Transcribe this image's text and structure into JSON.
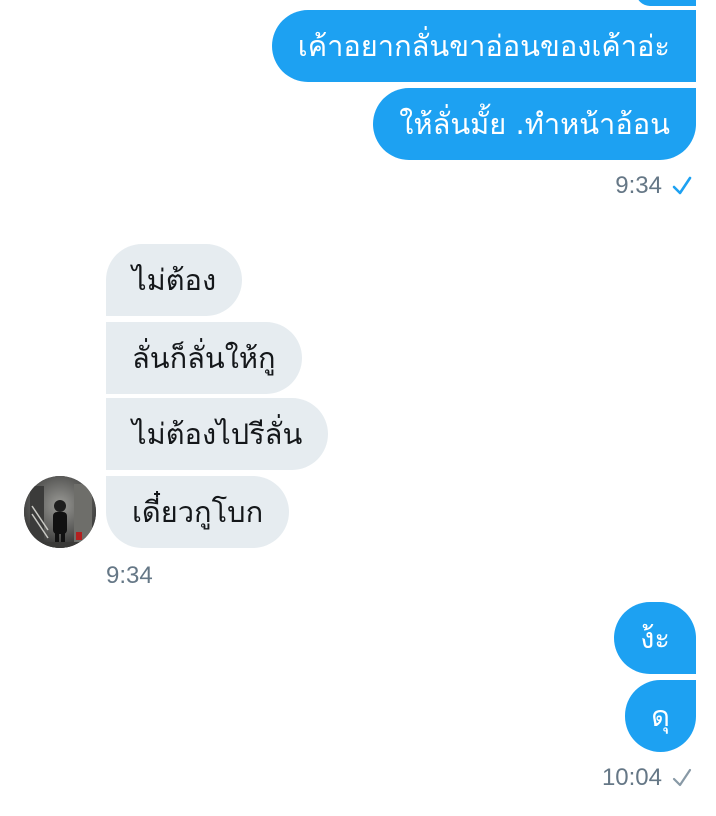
{
  "conversation": {
    "outgoing_group_1": {
      "messages": [
        "เค้าอยากลั่นขาอ่อนของเค้าอ่ะ",
        "ให้ลั่นมั้ย .ทำหน้าอ้อน"
      ],
      "time": "9:34",
      "status_icon": "check-icon",
      "status_color": "#1da1f2"
    },
    "incoming_group": {
      "messages": [
        "ไม่ต้อง",
        "ลั่นก็ลั่นให้กู",
        "ไม่ต้องไปรีลั่น",
        "เดี๋ยวกูโบก"
      ],
      "time": "9:34",
      "avatar_icon": "user-avatar"
    },
    "outgoing_group_2": {
      "messages": [
        "ง้ะ",
        "ดุ"
      ],
      "time": "10:04",
      "status_icon": "check-icon",
      "status_color": "#8899a6"
    }
  },
  "colors": {
    "outgoing_bubble": "#1da1f2",
    "incoming_bubble": "#e6ecf0",
    "meta_text": "#657786"
  }
}
